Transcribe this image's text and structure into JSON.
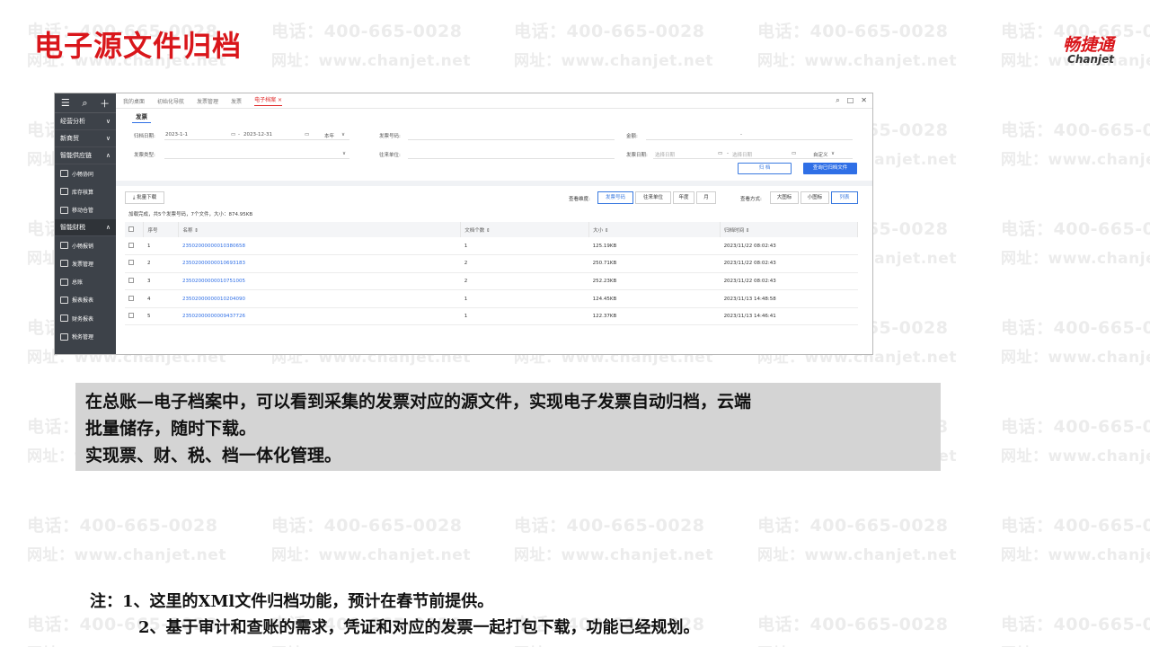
{
  "slide": {
    "title": "电子源文件归档",
    "brand_cn": "畅捷通",
    "brand_en": "Chanjet"
  },
  "watermark": {
    "phone": "电话：400-665-0028",
    "website": "网址：www.chanjet.net"
  },
  "app": {
    "sidebar": {
      "items": [
        {
          "label": "经营分析",
          "toggle": "∨"
        },
        {
          "label": "新商贸",
          "toggle": "∨"
        },
        {
          "label": "智能供应链",
          "toggle": "∧"
        }
      ],
      "supply_sub": [
        "小畅协同",
        "库存核算",
        "移动仓管"
      ],
      "finance": {
        "label": "智能财税",
        "toggle": "∧"
      },
      "finance_sub": [
        "小畅报销",
        "发票管理",
        "总账",
        "报表报表",
        "财务报表",
        "税务管理"
      ]
    },
    "tabs": [
      "我的桌面",
      "初始化导航",
      "发票管理",
      "发票",
      "电子档案"
    ],
    "active_tab_close": "×",
    "subtab": "发票",
    "filters": {
      "archive_date_label": "归档日期:",
      "date_from": "2023-1-1",
      "date_sep": "-",
      "date_to": "2023-12-31",
      "period": "本年",
      "invoice_no_label": "发票号码:",
      "amount_label": "金额:",
      "amount_sep": "-",
      "invoice_type_label": "发票类型:",
      "partner_label": "往来单位:",
      "invoice_date_label": "发票日期:",
      "invoice_date_placeholder": "选择日期",
      "invoice_date_placeholder2": "选择日期",
      "custom": "自定义",
      "archive_btn": "归 档",
      "query_btn": "查询已归档文件"
    },
    "toolbar": {
      "batch_download": "批量下载",
      "dimension_label": "查看维度:",
      "dimensions": [
        "发票号码",
        "往来单位",
        "年度",
        "月"
      ],
      "view_label": "查看方式:",
      "views": [
        "大图标",
        "小图标",
        "列表"
      ]
    },
    "loaded_text": "加载完成，共5个发票号码，7个文件，大小：874.95KB",
    "table": {
      "headers": [
        "序号",
        "名称 ⇕",
        "文档个数 ⇕",
        "大小 ⇕",
        "归档时间 ⇕"
      ],
      "rows": [
        {
          "idx": "1",
          "name": "23502000000010380658",
          "count": "1",
          "size": "125.19KB",
          "time": "2023/11/22 08:02:43"
        },
        {
          "idx": "2",
          "name": "23502000000010693183",
          "count": "2",
          "size": "250.71KB",
          "time": "2023/11/22 08:02:43"
        },
        {
          "idx": "3",
          "name": "23502000000010751005",
          "count": "2",
          "size": "252.23KB",
          "time": "2023/11/22 08:02:43"
        },
        {
          "idx": "4",
          "name": "23502000000010204090",
          "count": "1",
          "size": "124.45KB",
          "time": "2023/11/13 14:48:58"
        },
        {
          "idx": "5",
          "name": "23502000000009437726",
          "count": "1",
          "size": "122.37KB",
          "time": "2023/11/13 14:46:41"
        }
      ]
    }
  },
  "description": {
    "line1": "在总账—电子档案中，可以看到采集的发票对应的源文件，实现电子发票自动归档，云端",
    "line2": "批量储存，随时下载。",
    "line3": "实现票、财、税、档一体化管理。"
  },
  "notes": {
    "line1": "注：1、这里的XMl文件归档功能，预计在春节前提供。",
    "line2": "2、基于审计和查账的需求，凭证和对应的发票一起打包下载，功能已经规划。"
  }
}
